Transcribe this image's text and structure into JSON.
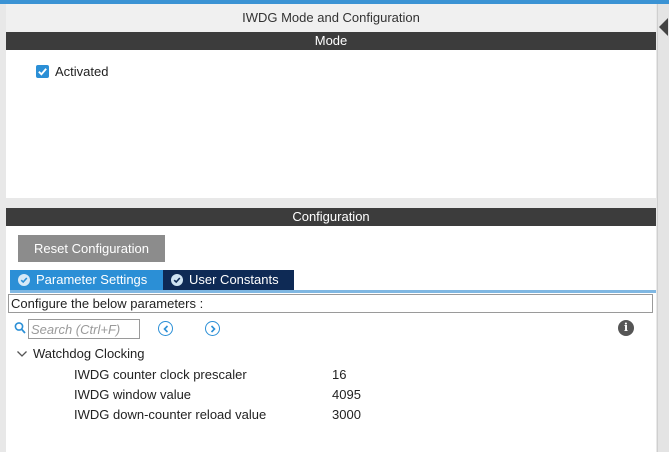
{
  "window": {
    "title": "IWDG Mode and Configuration"
  },
  "mode": {
    "header": "Mode",
    "activated": {
      "label": "Activated",
      "checked": true
    }
  },
  "configuration": {
    "header": "Configuration",
    "reset_label": "Reset Configuration",
    "tabs": [
      {
        "label": "Parameter Settings",
        "active": true
      },
      {
        "label": "User Constants",
        "active": false
      }
    ],
    "instruction": "Configure the below parameters :",
    "search": {
      "placeholder": "Search (Ctrl+F)",
      "value": ""
    },
    "group": {
      "label": "Watchdog Clocking",
      "expanded": true,
      "params": [
        {
          "name": "IWDG counter clock prescaler",
          "value": "16"
        },
        {
          "name": "IWDG window value",
          "value": "4095"
        },
        {
          "name": "IWDG down-counter reload value",
          "value": "3000"
        }
      ]
    }
  },
  "colors": {
    "accent": "#2b8fd6",
    "header_bg": "#3c3c3c",
    "inactive_tab": "#0e2a55",
    "reset_button": "#8c8c8c"
  },
  "icons": [
    "check-icon",
    "search-icon",
    "prev-icon",
    "next-icon",
    "info-icon",
    "chevron-down-icon",
    "collapse-arrow-icon"
  ]
}
